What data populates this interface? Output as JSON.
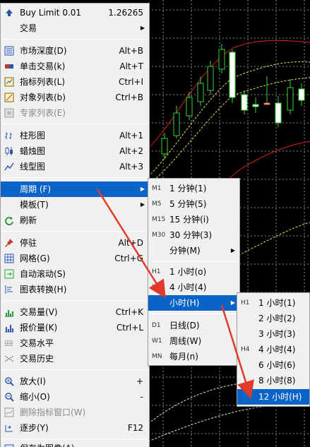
{
  "main_menu": {
    "buy_limit": {
      "label": "Buy Limit 0.01",
      "shortcut": "1.26265"
    },
    "trade": {
      "label": "交易"
    },
    "depth": {
      "label": "市场深度(D)",
      "shortcut": "Alt+B"
    },
    "one_click": {
      "label": "单击交易(k)",
      "shortcut": "Alt+T"
    },
    "indicators": {
      "label": "指标列表(L)",
      "shortcut": "Ctrl+I"
    },
    "objects": {
      "label": "对象列表(b)",
      "shortcut": "Ctrl+B"
    },
    "experts": {
      "label": "专家列表(E)"
    },
    "bar_chart": {
      "label": "柱形图",
      "shortcut": "Alt+1"
    },
    "candle_chart": {
      "label": "蜡烛图",
      "shortcut": "Alt+2"
    },
    "line_chart": {
      "label": "线型图",
      "shortcut": "Alt+3"
    },
    "period": {
      "label": "周期 (F)"
    },
    "template": {
      "label": "模板(T)"
    },
    "refresh": {
      "label": "刷新"
    },
    "dock": {
      "label": "停驻",
      "shortcut": "Alt+D"
    },
    "grid": {
      "label": "网格(G)",
      "shortcut": "Ctrl+G"
    },
    "autoscroll": {
      "label": "自动滚动(S)"
    },
    "chart_shift": {
      "label": "图表转换(H)"
    },
    "volume": {
      "label": "交易量(V)",
      "shortcut": "Ctrl+K"
    },
    "tick_volume": {
      "label": "报价量(K)",
      "shortcut": "Ctrl+L"
    },
    "trade_levels": {
      "label": "交易水平"
    },
    "trade_history": {
      "label": "交易历史"
    },
    "zoom_in": {
      "label": "放大(I)",
      "shortcut": "+"
    },
    "zoom_out": {
      "label": "缩小(O)",
      "shortcut": "-"
    },
    "delete_indicator_window": {
      "label": "删除指标窗口(W)"
    },
    "step": {
      "label": "逐步(Y)",
      "shortcut": "F12"
    },
    "save_image": {
      "label": "保存为图像(A)"
    }
  },
  "period_menu": {
    "m1": {
      "tag": "M1",
      "label": "1 分钟(1)"
    },
    "m5": {
      "tag": "M5",
      "label": "5 分钟(5)"
    },
    "m15": {
      "tag": "M15",
      "label": "15 分钟(i)"
    },
    "m30": {
      "tag": "M30",
      "label": "30 分钟(3)"
    },
    "minutes": {
      "label": "分钟(M)"
    },
    "h1": {
      "tag": "H1",
      "label": "1 小时(o)"
    },
    "h4": {
      "tag": "H4",
      "label": "4 小时(4)"
    },
    "hours": {
      "label": "小时(H)"
    },
    "d1": {
      "tag": "D1",
      "label": "日线(D)"
    },
    "w1": {
      "tag": "W1",
      "label": "周线(W)"
    },
    "mn": {
      "tag": "MN",
      "label": "每月(n)"
    }
  },
  "hours_menu": {
    "h1": {
      "tag": "H1",
      "label": "1 小时(1)"
    },
    "h2": {
      "label": "2 小时(2)"
    },
    "h3": {
      "label": "3 小时(3)"
    },
    "h4": {
      "tag": "H4",
      "label": "4 小时(4)"
    },
    "h6": {
      "label": "6 小时(6)"
    },
    "h8": {
      "label": "8 小时(8)"
    },
    "h12": {
      "label": "12 小时(H)"
    }
  },
  "colors": {
    "selection": "#0a64c8",
    "chart_bg": "#000000",
    "annotation_arrow": "#e03a2a"
  }
}
